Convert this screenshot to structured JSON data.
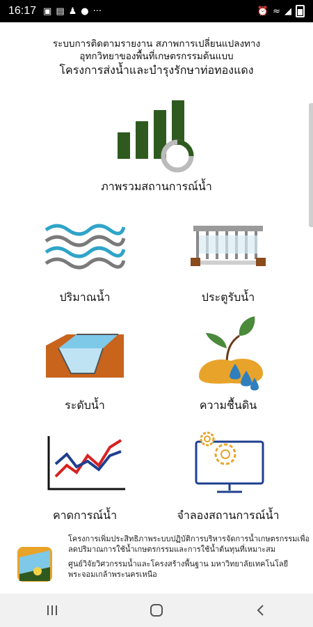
{
  "status_bar": {
    "time": "16:17",
    "left_icons": [
      "image-icon",
      "sim-icon",
      "person-icon",
      "messenger-icon",
      "more-icon"
    ],
    "right_icons": [
      "alarm-icon",
      "wifi-icon",
      "signal-icon",
      "battery-icon"
    ]
  },
  "header": {
    "line1": "ระบบการติดตามรายงาน สภาพการเปลี่ยนแปลงทาง",
    "line2": "อุทกวิทยาของพื้นที่เกษตรกรรมต้นแบบ",
    "line3": "โครงการส่งน้ำและบำรุงรักษาท่อทองแดง"
  },
  "overview": {
    "label": "ภาพรวมสถานการณ์น้ำ",
    "icon": "bar-chart-icon"
  },
  "menu": {
    "water_volume": "ปริมาณน้ำ",
    "water_gate": "ประตูรับน้ำ",
    "water_level": "ระดับน้ำ",
    "soil_moisture": "ความชื้นดิน",
    "water_forecast": "คาดการณ์น้ำ",
    "water_simulation": "จำลองสถานการณ์น้ำ"
  },
  "footer": {
    "text1": "โครงการเพิ่มประสิทธิภาพระบบปฏิบัติการบริหารจัดการน้ำเกษตรกรรมเพื่อลดปริมาณการใช้น้ำเกษตรกรรมและการใช้น้ำต้นทุนที่เหมาะสม",
    "text2": "ศูนย์วิจัยวิศวกรรมน้ำและโครงสร้างพื้นฐาน มหาวิทยาลัยเทคโนโลยีพระจอมเกล้าพระนครเหนือ"
  },
  "nav": [
    "recent-apps-icon",
    "home-icon",
    "back-icon"
  ],
  "colors": {
    "green": "#2f5a1f",
    "blue": "#2fa4c8",
    "gray": "#7a7a7a",
    "orange": "#e8a42a",
    "red": "#d92020",
    "navy": "#1f3f8f"
  }
}
